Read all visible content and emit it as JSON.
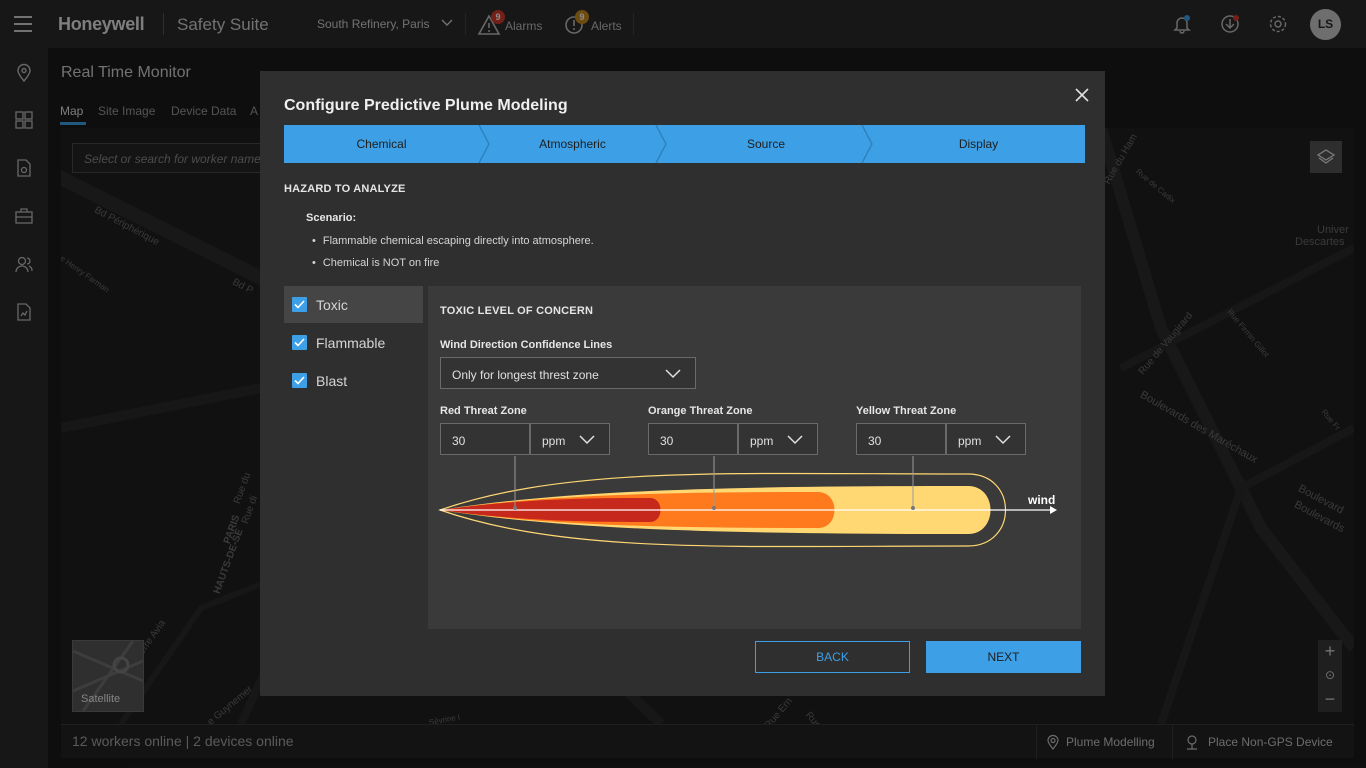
{
  "topbar": {
    "brand": "Honeywell",
    "suite": "Safety Suite",
    "site": "South Refinery, Paris",
    "alarms_label": "Alarms",
    "alarms_count": "9",
    "alerts_label": "Alerts",
    "alerts_count": "9",
    "avatar_initials": "LS"
  },
  "page": {
    "title": "Real Time Monitor",
    "tabs": [
      "Map",
      "Site Image",
      "Device Data",
      "A"
    ],
    "search_placeholder": "Select or search for worker name"
  },
  "map": {
    "labels": [
      "Bd Périphérique",
      "Bd P",
      "e Henry Farman",
      "Rue du",
      "PARIS",
      "HAUTS-DE-SE",
      "Rue di",
      "erre Avia",
      "e Guynemer",
      "Rue du Ham",
      "Rue de Cadix",
      "Univer",
      "Descartes",
      "Rue de Vaugirard",
      "Rue Firmin Gillot",
      "Boulevards des Maréchaux",
      "Rue Fr",
      "Boulevard",
      "Boulevards",
      "Rue Ern",
      "Rue de",
      "Sèvrine l"
    ],
    "satellite_label": "Satellite"
  },
  "statusbar": {
    "text": "12 workers online | 2 devices online",
    "plume_btn": "Plume Modelling",
    "place_btn": "Place Non-GPS Device"
  },
  "modal": {
    "title": "Configure Predictive Plume Modeling",
    "steps": [
      "Chemical",
      "Atmospheric",
      "Source",
      "Display"
    ],
    "hazard_heading": "HAZARD TO ANALYZE",
    "scenario_heading": "Scenario:",
    "scenario_bullets": [
      "Flammable chemical escaping directly into atmosphere.",
      "Chemical is NOT on fire"
    ],
    "categories": [
      {
        "label": "Toxic",
        "checked": true
      },
      {
        "label": "Flammable",
        "checked": true
      },
      {
        "label": "Blast",
        "checked": true
      }
    ],
    "panel_heading": "TOXIC LEVEL OF CONCERN",
    "wind_label": "Wind Direction Confidence Lines",
    "wind_value": "Only for longest threst zone",
    "zones": [
      {
        "label": "Red Threat Zone",
        "value": "30",
        "unit": "ppm",
        "color": "#c6281b"
      },
      {
        "label": "Orange Threat Zone",
        "value": "30",
        "unit": "ppm",
        "color": "#ff7a1c"
      },
      {
        "label": "Yellow Threat Zone",
        "value": "30",
        "unit": "ppm",
        "color": "#ffd873"
      }
    ],
    "wind_arrow_label": "wind",
    "back_label": "BACK",
    "next_label": "NEXT"
  }
}
